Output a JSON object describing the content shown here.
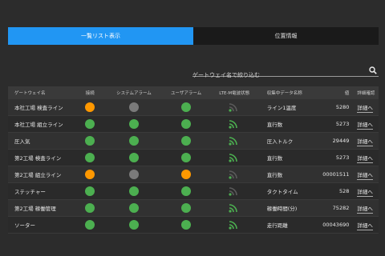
{
  "tabs": [
    {
      "label": "一覧リスト表示",
      "active": true
    },
    {
      "label": "位置情報",
      "active": false
    }
  ],
  "search": {
    "placeholder": "ゲートウェイ名で絞り込む",
    "icon": "search-icon"
  },
  "table": {
    "headers": [
      "ゲートウェイ名",
      "接続",
      "システムアラーム",
      "ユーザアラーム",
      "LTE-M電波状態",
      "収集中データ名称",
      "値",
      "詳細確認"
    ],
    "rows": [
      {
        "name": "本社工場 検査ライン",
        "conn": "orange",
        "sys": "gray",
        "user": "green",
        "lte": 1,
        "data": "ライン1温度",
        "value": "5280",
        "detail": "詳細へ"
      },
      {
        "name": "本社工場 組立ライン",
        "conn": "green",
        "sys": "green",
        "user": "green",
        "lte": 3,
        "data": "直行数",
        "value": "5273",
        "detail": "詳細へ"
      },
      {
        "name": "圧入気",
        "conn": "green",
        "sys": "green",
        "user": "green",
        "lte": 3,
        "data": "圧入トルク",
        "value": "29449",
        "detail": "詳細へ"
      },
      {
        "name": "第2工場 検査ライン",
        "conn": "green",
        "sys": "green",
        "user": "green",
        "lte": 3,
        "data": "直行数",
        "value": "5273",
        "detail": "詳細へ"
      },
      {
        "name": "第2工場 組立ライン",
        "conn": "orange",
        "sys": "gray",
        "user": "orange",
        "lte": 1,
        "data": "直行数",
        "value": "00001511",
        "detail": "詳細へ"
      },
      {
        "name": "ステッチャー",
        "conn": "green",
        "sys": "green",
        "user": "green",
        "lte": 1,
        "data": "タクトタイム",
        "value": "528",
        "detail": "詳細へ"
      },
      {
        "name": "第2工場 稼働管理",
        "conn": "green",
        "sys": "green",
        "user": "green",
        "lte": 3,
        "data": "稼働時間(分)",
        "value": "75282",
        "detail": "詳細へ"
      },
      {
        "name": "ソーター",
        "conn": "green",
        "sys": "green",
        "user": "green",
        "lte": 3,
        "data": "走行距離",
        "value": "00043690",
        "detail": "詳細へ"
      }
    ]
  },
  "colors": {
    "accent": "#2196f3",
    "green": "#4caf50",
    "orange": "#ff9800",
    "gray": "#7a7a7a"
  }
}
